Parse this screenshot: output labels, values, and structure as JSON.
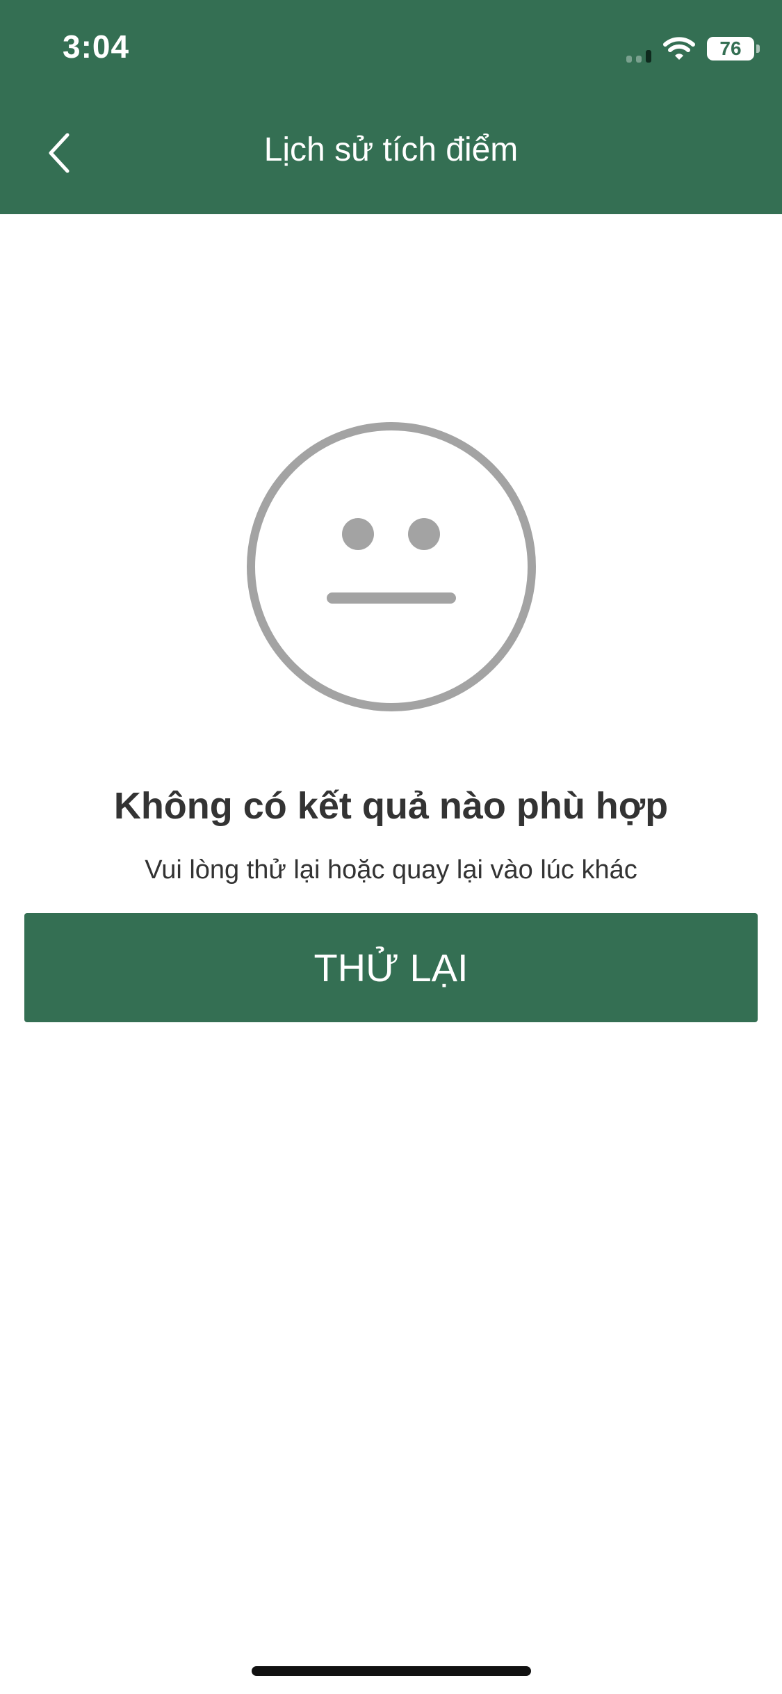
{
  "status_bar": {
    "time": "3:04",
    "battery": "76",
    "icons": [
      "cellular-signal-icon",
      "wifi-icon",
      "battery-icon"
    ]
  },
  "header": {
    "back_icon": "chevron-left-icon",
    "title": "Lịch sử tích điểm"
  },
  "empty_state": {
    "icon": "neutral-face-icon",
    "title": "Không có kết quả nào phù hợp",
    "subtitle": "Vui lòng thử lại hoặc quay lại vào lúc khác",
    "retry_label": "THỬ LẠI"
  },
  "colors": {
    "primary": "#346f53",
    "icon_gray": "#a3a3a3",
    "text_dark": "#333333",
    "background": "#ffffff"
  }
}
